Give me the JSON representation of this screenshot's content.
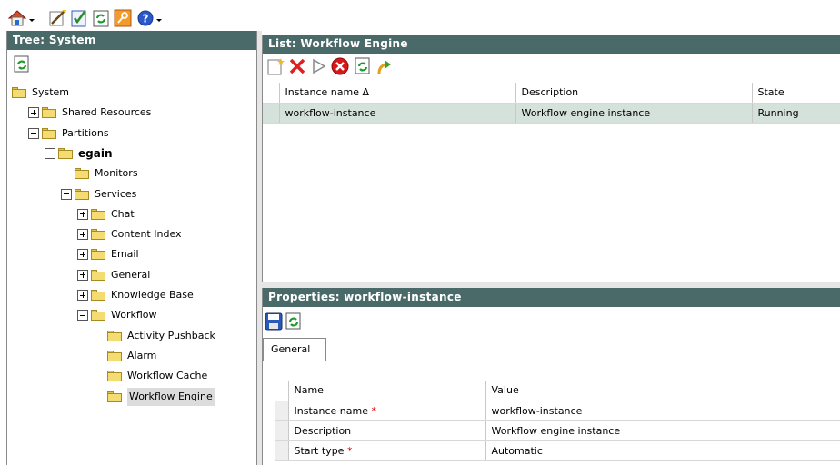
{
  "toolbar": {
    "icons": [
      "home-icon",
      "wizard-icon",
      "checklist-icon",
      "refresh-icon",
      "key-icon",
      "help-icon"
    ]
  },
  "tree_panel": {
    "title": "Tree: System",
    "items": [
      {
        "label": "System",
        "level": 0,
        "expander": "none"
      },
      {
        "label": "Shared Resources",
        "level": 1,
        "expander": "plus"
      },
      {
        "label": "Partitions",
        "level": 1,
        "expander": "minus"
      },
      {
        "label": "egain",
        "level": 2,
        "expander": "minus"
      },
      {
        "label": "Monitors",
        "level": 3,
        "expander": "none"
      },
      {
        "label": "Services",
        "level": 3,
        "expander": "minus"
      },
      {
        "label": "Chat",
        "level": 4,
        "expander": "plus"
      },
      {
        "label": "Content Index",
        "level": 4,
        "expander": "plus"
      },
      {
        "label": "Email",
        "level": 4,
        "expander": "plus"
      },
      {
        "label": "General",
        "level": 4,
        "expander": "plus"
      },
      {
        "label": "Knowledge Base",
        "level": 4,
        "expander": "plus"
      },
      {
        "label": "Workflow",
        "level": 4,
        "expander": "minus"
      },
      {
        "label": "Activity Pushback",
        "level": 5,
        "expander": "none"
      },
      {
        "label": "Alarm",
        "level": 5,
        "expander": "none"
      },
      {
        "label": "Workflow Cache",
        "level": 5,
        "expander": "none"
      },
      {
        "label": "Workflow Engine",
        "level": 5,
        "expander": "none",
        "selected": true
      }
    ]
  },
  "list_panel": {
    "title": "List: Workflow Engine",
    "columns": [
      "Instance name Δ",
      "Description",
      "State"
    ],
    "rows": [
      [
        "workflow-instance",
        "Workflow engine instance",
        "Running"
      ]
    ]
  },
  "properties_panel": {
    "title": "Properties: workflow-instance",
    "tab": "General",
    "columns": [
      "Name",
      "Value"
    ],
    "rows": [
      {
        "name": "Instance name",
        "required": "*",
        "value": "workflow-instance"
      },
      {
        "name": "Description",
        "required": "",
        "value": "Workflow engine instance"
      },
      {
        "name": "Start type",
        "required": "*",
        "value": "Automatic"
      }
    ]
  },
  "colors": {
    "panel_header": "#4a6a6a",
    "selected_row": "#d5e2dc",
    "required_marker": "#dd0000"
  }
}
